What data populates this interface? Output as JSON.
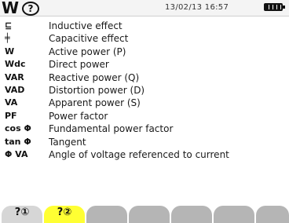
{
  "status": {
    "mode_glyph": "W",
    "help_glyph": "?",
    "datetime": "13/02/13 16:57"
  },
  "legend": [
    {
      "symbol": "⊑",
      "label": "Inductive effect"
    },
    {
      "symbol": "╪",
      "label": "Capacitive effect"
    },
    {
      "symbol": "W",
      "label": "Active power (P)"
    },
    {
      "symbol": "Wdc",
      "label": "Direct power"
    },
    {
      "symbol": "VAR",
      "label": "Reactive power (Q)"
    },
    {
      "symbol": "VAD",
      "label": "Distortion power (D)"
    },
    {
      "symbol": "VA",
      "label": "Apparent power (S)"
    },
    {
      "symbol": "PF",
      "label": "Power factor"
    },
    {
      "symbol": "cos Φ",
      "label": "Fundamental power factor"
    },
    {
      "symbol": "tan Φ",
      "label": "Tangent"
    },
    {
      "symbol": "Φ VA",
      "label": "Angle of voltage referenced to current"
    }
  ],
  "tabs": [
    {
      "label": "?①"
    },
    {
      "label": "?②"
    },
    {
      "label": ""
    },
    {
      "label": ""
    },
    {
      "label": ""
    },
    {
      "label": ""
    },
    {
      "label": ""
    }
  ]
}
